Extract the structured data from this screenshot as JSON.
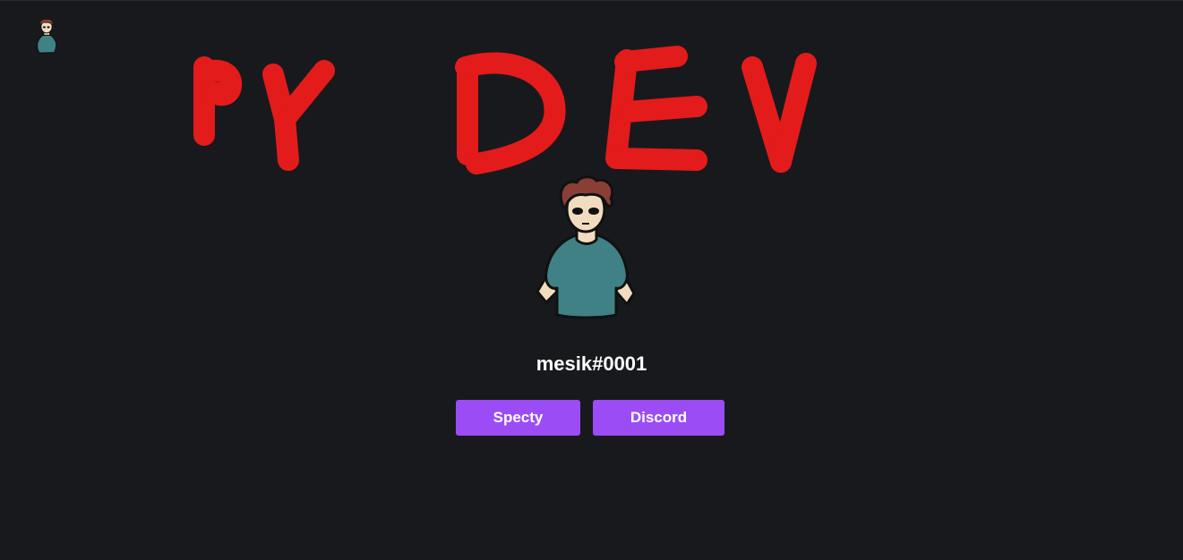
{
  "profile": {
    "username": "mesik#0001"
  },
  "logo": {
    "text": "PY DEV",
    "color": "#e41b1b"
  },
  "buttons": {
    "specty_label": "Specty",
    "discord_label": "Discord",
    "accent_color": "#9b4cf5"
  },
  "theme": {
    "background": "#18191d"
  }
}
